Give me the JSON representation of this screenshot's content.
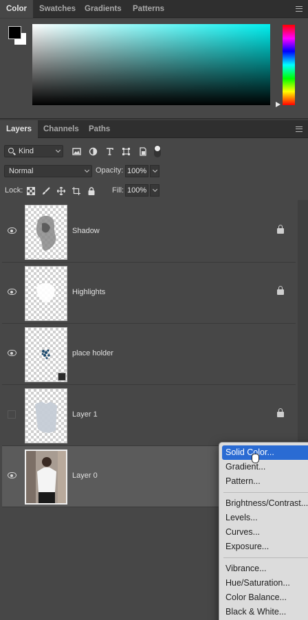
{
  "color_panel": {
    "tabs": [
      "Color",
      "Swatches",
      "Gradients",
      "Patterns"
    ],
    "active_tab": "Color",
    "foreground_color": "#000000",
    "background_color": "#ffffff",
    "selected_hue": "#00f0f0"
  },
  "layers_panel": {
    "tabs": [
      "Layers",
      "Channels",
      "Paths"
    ],
    "active_tab": "Layers",
    "filter_kind": "Kind",
    "blend_mode": "Normal",
    "opacity_label": "Opacity:",
    "opacity_value": "100%",
    "lock_label": "Lock:",
    "fill_label": "Fill:",
    "fill_value": "100%",
    "layers": [
      {
        "name": "Shadow",
        "visible": true,
        "locked": true
      },
      {
        "name": "Highlights",
        "visible": true,
        "locked": true
      },
      {
        "name": "place holder",
        "visible": true,
        "locked": false,
        "smart_object": true
      },
      {
        "name": "Layer 1",
        "visible": false,
        "locked": true
      },
      {
        "name": "Layer 0",
        "visible": true,
        "locked": false,
        "selected": true
      }
    ]
  },
  "adjustment_menu": {
    "items": [
      "Solid Color...",
      "Gradient...",
      "Pattern...",
      "Brightness/Contrast...",
      "Levels...",
      "Curves...",
      "Exposure...",
      "Vibrance...",
      "Hue/Saturation...",
      "Color Balance...",
      "Black & White..."
    ],
    "highlighted": "Solid Color..."
  }
}
